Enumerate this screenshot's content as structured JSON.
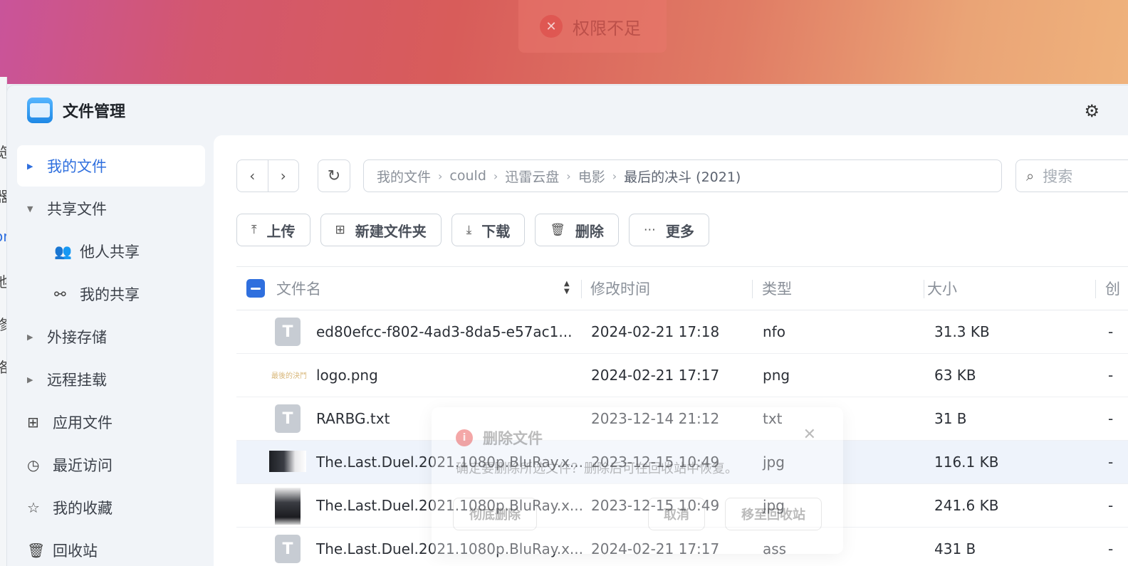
{
  "toast": {
    "message": "权限不足"
  },
  "window": {
    "title": "文件管理"
  },
  "background_glyphs": [
    "览",
    "器",
    "or",
    "地",
    "修",
    "络"
  ],
  "sidebar": {
    "items": [
      {
        "label": "我的文件"
      },
      {
        "label": "共享文件"
      },
      {
        "label": "他人共享"
      },
      {
        "label": "我的共享"
      },
      {
        "label": "外接存储"
      },
      {
        "label": "远程挂载"
      },
      {
        "label": "应用文件"
      },
      {
        "label": "最近访问"
      },
      {
        "label": "我的收藏"
      },
      {
        "label": "回收站"
      }
    ]
  },
  "breadcrumb": [
    "我的文件",
    "could",
    "迅雷云盘",
    "电影",
    "最后的决斗 (2021)"
  ],
  "search": {
    "placeholder": "搜索"
  },
  "toolbar": {
    "upload": "上传",
    "new_folder": "新建文件夹",
    "download": "下载",
    "delete": "删除",
    "more": "更多"
  },
  "table": {
    "headers": {
      "name": "文件名",
      "modified": "修改时间",
      "type": "类型",
      "size": "大小",
      "created": "创"
    },
    "rows": [
      {
        "name": "ed80efcc-f802-4ad3-8da5-e57ac1...",
        "modified": "2024-02-21 17:18",
        "type": "nfo",
        "size": "31.3 KB",
        "extra": "-",
        "icon_letter": "T"
      },
      {
        "name": "logo.png",
        "modified": "2024-02-21 17:17",
        "type": "png",
        "size": "63 KB",
        "extra": "-",
        "logo_text": "最後的決鬥"
      },
      {
        "name": "RARBG.txt",
        "modified": "2023-12-14 21:12",
        "type": "txt",
        "size": "31 B",
        "extra": "-",
        "icon_letter": "T"
      },
      {
        "name": "The.Last.Duel.2021.1080p.BluRay.x...",
        "modified": "2023-12-15 10:49",
        "type": "jpg",
        "size": "116.1 KB",
        "extra": "-"
      },
      {
        "name": "The.Last.Duel.2021.1080p.BluRay.x...",
        "modified": "2023-12-15 10:49",
        "type": "jpg",
        "size": "241.6 KB",
        "extra": "-"
      },
      {
        "name": "The.Last.Duel.2021.1080p.BluRay.x...",
        "modified": "2024-02-21 17:17",
        "type": "ass",
        "size": "431 B",
        "extra": "-",
        "icon_letter": "T"
      }
    ]
  },
  "dialog": {
    "title": "删除文件",
    "message": "确定要删除所选文件？删除后可在回收站中恢复。",
    "btn_permanent": "彻底删除",
    "btn_cancel": "取消",
    "btn_recycle": "移至回收站"
  },
  "colors": {
    "accent": "#2f6fde",
    "highlight_row": "#eef3fb",
    "danger": "#e63c3c"
  }
}
